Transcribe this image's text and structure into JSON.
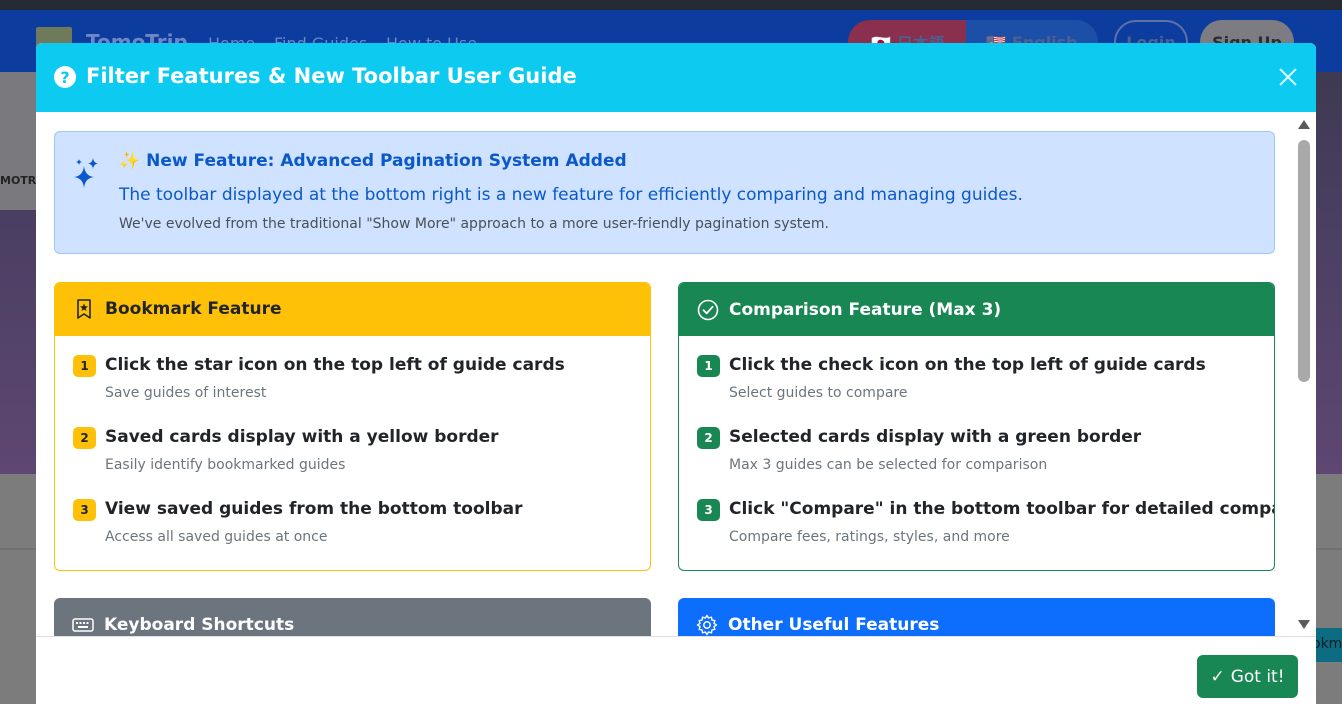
{
  "background": {
    "brand": "TomoTrip",
    "nav_links": [
      "Home",
      "Find Guides",
      "How to Use"
    ],
    "lang_jp": "🇯🇵 日本語",
    "lang_en": "🇺🇸 English",
    "login": "Login",
    "signup": "Sign Up",
    "hero_card_text": "MOTR",
    "side_chip": "okma"
  },
  "modal": {
    "title": "Filter Features & New Toolbar User Guide",
    "header_icon": "question-circle-icon",
    "close_icon": "close-icon",
    "alert": {
      "icon": "stars-icon",
      "title_emoji": "✨",
      "title": "New Feature: Advanced Pagination System Added",
      "main": "The toolbar displayed at the bottom right is a new feature for efficiently comparing and managing guides.",
      "sub": "We've evolved from the traditional \"Show More\" approach to a more user-friendly pagination system."
    },
    "bookmark": {
      "icon": "bookmark-star-icon",
      "title": "Bookmark Feature",
      "color": "#ffc107",
      "steps": [
        {
          "num": "1",
          "title": "Click the star icon on the top left of guide cards",
          "sub": "Save guides of interest"
        },
        {
          "num": "2",
          "title": "Saved cards display with a yellow border",
          "sub": "Easily identify bookmarked guides"
        },
        {
          "num": "3",
          "title": "View saved guides from the bottom toolbar",
          "sub": "Access all saved guides at once"
        }
      ]
    },
    "comparison": {
      "icon": "check-circle-icon",
      "title": "Comparison Feature (Max 3)",
      "color": "#198754",
      "steps": [
        {
          "num": "1",
          "title": "Click the check icon on the top left of guide cards",
          "sub": "Select guides to compare"
        },
        {
          "num": "2",
          "title": "Selected cards display with a green border",
          "sub": "Max 3 guides can be selected for comparison"
        },
        {
          "num": "3",
          "title": "Click \"Compare\" in the bottom toolbar for detailed comparison",
          "sub": "Compare fees, ratings, styles, and more"
        }
      ]
    },
    "keyboard": {
      "icon": "keyboard-icon",
      "title": "Keyboard Shortcuts",
      "color": "#6c757d"
    },
    "other": {
      "icon": "gear-icon",
      "title": "Other Useful Features",
      "color": "#0d6efd"
    },
    "got_it": {
      "check": "✓",
      "label": "Got it!"
    }
  },
  "colors": {
    "header": "#0dcaf0",
    "alert_bg": "#cfe2ff",
    "alert_text": "#0a58ca",
    "success": "#198754"
  }
}
